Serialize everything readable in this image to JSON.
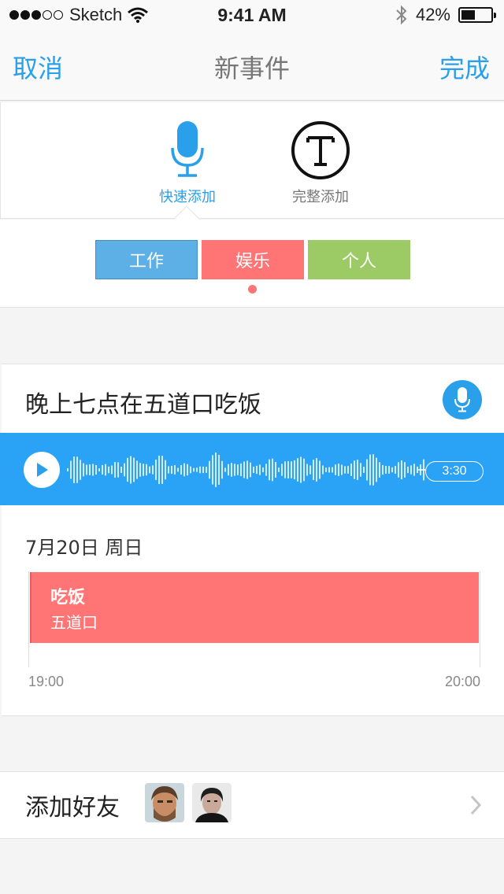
{
  "status_bar": {
    "carrier": "Sketch",
    "time": "9:41 AM",
    "battery": "42%",
    "battery_level": 0.42
  },
  "nav": {
    "cancel": "取消",
    "title": "新事件",
    "done": "完成"
  },
  "modes": {
    "quick": {
      "label": "快速添加",
      "icon": "microphone-icon"
    },
    "full": {
      "label": "完整添加",
      "icon": "text-t-icon"
    }
  },
  "categories": {
    "work": "工作",
    "fun": "娱乐",
    "personal": "个人",
    "selected": "fun"
  },
  "event": {
    "text": "晚上七点在五道口吃饭",
    "duration": "3:30",
    "date": "7月20日 周日",
    "block_title": "吃饭",
    "block_location": "五道口",
    "time_start": "19:00",
    "time_end": "20:00"
  },
  "friends": {
    "label": "添加好友"
  },
  "colors": {
    "accent": "#2a9fea",
    "work": "#5db0e6",
    "fun": "#ff7475",
    "personal": "#9ccb65"
  }
}
